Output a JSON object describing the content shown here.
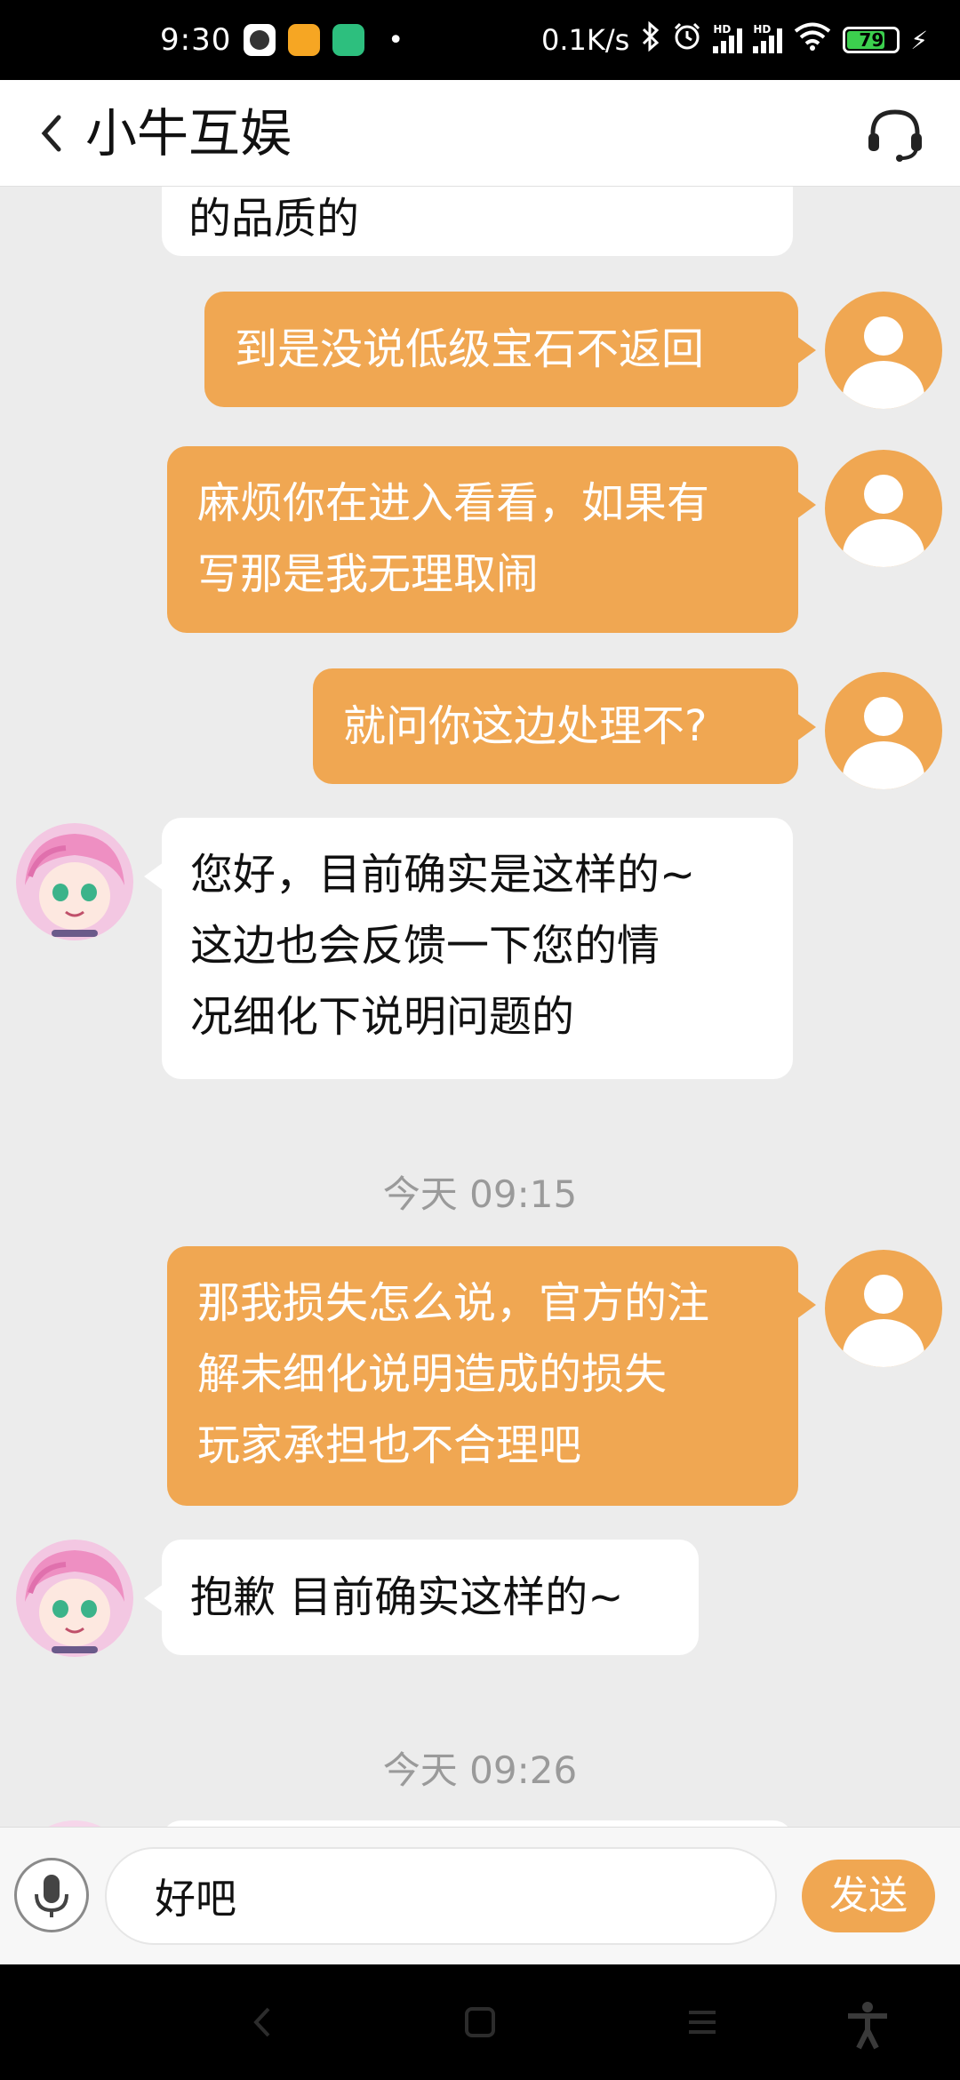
{
  "status_bar": {
    "time": "9:30",
    "net_speed": "0.1K/s",
    "battery": "79",
    "signal_label_1": "HD",
    "signal_label_2": "HD"
  },
  "header": {
    "title": "小牛互娱",
    "back_icon": "chevron-left-icon",
    "support_icon": "headset-icon"
  },
  "messages": [
    {
      "from": "agent",
      "text": "的品质的"
    },
    {
      "from": "user",
      "text": "到是没说低级宝石不返回"
    },
    {
      "from": "user",
      "lines": [
        "麻烦你在进入看看，如果有",
        "写那是我无理取闹"
      ]
    },
    {
      "from": "user",
      "text": "就问你这边处理不?"
    },
    {
      "from": "agent",
      "lines": [
        "您好，目前确实是这样的~",
        "这边也会反馈一下您的情",
        "况细化下说明问题的"
      ]
    },
    {
      "from": "user",
      "lines": [
        "那我损失怎么说，官方的注",
        "解未细化说明造成的损失",
        "玩家承担也不合理吧"
      ]
    },
    {
      "from": "agent",
      "text": "抱歉 目前确实这样的~"
    }
  ],
  "timestamps": [
    "今天 09:15",
    "今天 09:26"
  ],
  "input": {
    "value": "好吧",
    "send_label": "发送"
  },
  "colors": {
    "accent": "#f0a752",
    "chat_bg": "#ececec",
    "timestamp": "#9a9a9a"
  }
}
